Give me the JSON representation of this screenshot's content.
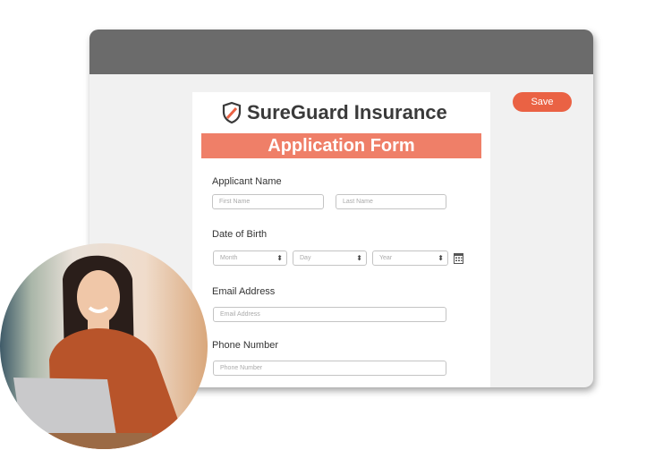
{
  "window": {
    "save_label": "Save"
  },
  "form": {
    "brand": "SureGuard Insurance",
    "title": "Application Form",
    "applicant_name": {
      "label": "Applicant Name",
      "first_placeholder": "First Name",
      "last_placeholder": "Last Name"
    },
    "dob": {
      "label": "Date of Birth",
      "month": "Month",
      "day": "Day",
      "year": "Year"
    },
    "email": {
      "label": "Email Address",
      "placeholder": "Email Address"
    },
    "phone": {
      "label": "Phone Number",
      "placeholder": "Phone Number"
    }
  },
  "colors": {
    "accent": "#ea6244",
    "banner": "#ef7f68",
    "titlebar": "#6b6b6b"
  }
}
